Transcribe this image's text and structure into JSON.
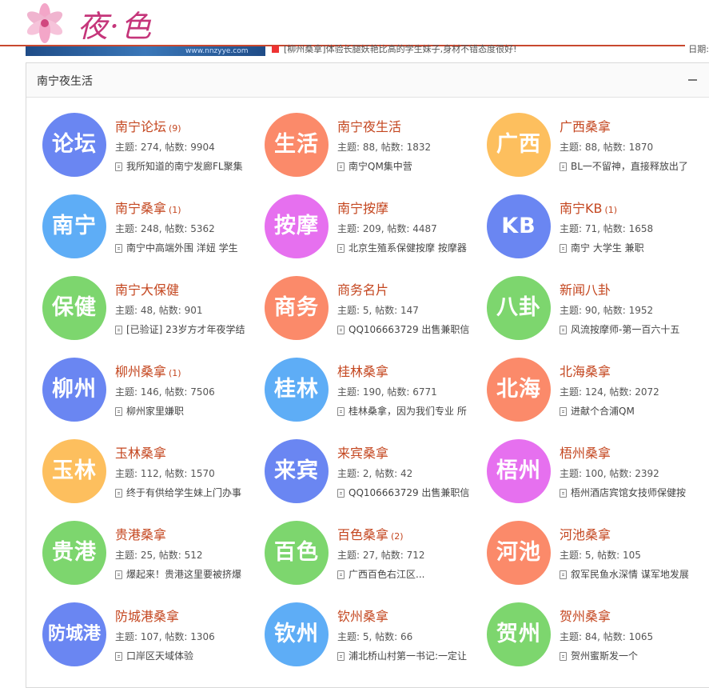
{
  "header": {
    "logo_text": "夜·色",
    "banner_url": "www.nnzyye.com",
    "ticker_text": "[柳州桑拿]体验长腿妖艳比高的学生妹子,身材不错态度很好!",
    "ticker_right": "日期:"
  },
  "panel": {
    "title": "南宁夜生活"
  },
  "labels": {
    "stats_prefix_topics": "主题: ",
    "stats_prefix_posts": "帖数: "
  },
  "forums": [
    {
      "badge": "论坛",
      "color": "#6a86f2",
      "name": "南宁论坛",
      "count": "(9)",
      "topics": "274",
      "posts": "9904",
      "last": "我所知道的南宁发廊FL聚集"
    },
    {
      "badge": "生活",
      "color": "#fb8a6a",
      "name": "南宁夜生活",
      "count": "",
      "topics": "88",
      "posts": "1832",
      "last": "南宁QM集中营"
    },
    {
      "badge": "广西",
      "color": "#fdbf5e",
      "name": "广西桑拿",
      "count": "",
      "topics": "88",
      "posts": "1870",
      "last": "BL一不留神，直接释放出了"
    },
    {
      "badge": "南宁",
      "color": "#5eadf6",
      "name": "南宁桑拿",
      "count": "(1)",
      "topics": "248",
      "posts": "5362",
      "last": "南宁中高端外围 洋妞 学生"
    },
    {
      "badge": "按摩",
      "color": "#e670ef",
      "name": "南宁按摩",
      "count": "",
      "topics": "209",
      "posts": "4487",
      "last": "北京生殖系保健按摩 按摩器"
    },
    {
      "badge": "KB",
      "color": "#6a86f2",
      "name": "南宁KB",
      "count": "(1)",
      "topics": "71",
      "posts": "1658",
      "last": "南宁 大学生 兼职"
    },
    {
      "badge": "保健",
      "color": "#7dd66e",
      "name": "南宁大保健",
      "count": "",
      "topics": "48",
      "posts": "901",
      "last": "[已验证] 23岁方才年夜学结"
    },
    {
      "badge": "商务",
      "color": "#fb8a6a",
      "name": "商务名片",
      "count": "",
      "topics": "5",
      "posts": "147",
      "last": "QQ106663729 出售兼职信"
    },
    {
      "badge": "八卦",
      "color": "#7dd66e",
      "name": "新闻八卦",
      "count": "",
      "topics": "90",
      "posts": "1952",
      "last": "风流按摩师-第一百六十五"
    },
    {
      "badge": "柳州",
      "color": "#6a86f2",
      "name": "柳州桑拿",
      "count": "(1)",
      "topics": "146",
      "posts": "7506",
      "last": "柳州家里嫌职"
    },
    {
      "badge": "桂林",
      "color": "#5eadf6",
      "name": "桂林桑拿",
      "count": "",
      "topics": "190",
      "posts": "6771",
      "last": "桂林桑拿，因为我们专业 所"
    },
    {
      "badge": "北海",
      "color": "#fb8a6a",
      "name": "北海桑拿",
      "count": "",
      "topics": "124",
      "posts": "2072",
      "last": "进献个合浦QM"
    },
    {
      "badge": "玉林",
      "color": "#fdbf5e",
      "name": "玉林桑拿",
      "count": "",
      "topics": "112",
      "posts": "1570",
      "last": "终于有供给学生妹上门办事"
    },
    {
      "badge": "来宾",
      "color": "#6a86f2",
      "name": "来宾桑拿",
      "count": "",
      "topics": "2",
      "posts": "42",
      "last": "QQ106663729 出售兼职信"
    },
    {
      "badge": "梧州",
      "color": "#e670ef",
      "name": "梧州桑拿",
      "count": "",
      "topics": "100",
      "posts": "2392",
      "last": "梧州酒店宾馆女技师保健按"
    },
    {
      "badge": "贵港",
      "color": "#7dd66e",
      "name": "贵港桑拿",
      "count": "",
      "topics": "25",
      "posts": "512",
      "last": "爆起来！贵港这里要被挤爆"
    },
    {
      "badge": "百色",
      "color": "#7dd66e",
      "name": "百色桑拿",
      "count": "(2)",
      "topics": "27",
      "posts": "712",
      "last": "广西百色右江区..."
    },
    {
      "badge": "河池",
      "color": "#fb8a6a",
      "name": "河池桑拿",
      "count": "",
      "topics": "5",
      "posts": "105",
      "last": "叙军民鱼水深情 谋军地发展"
    },
    {
      "badge": "防城港",
      "color": "#6a86f2",
      "name": "防城港桑拿",
      "count": "",
      "topics": "107",
      "posts": "1306",
      "last": "口岸区天域体验"
    },
    {
      "badge": "钦州",
      "color": "#5eadf6",
      "name": "钦州桑拿",
      "count": "",
      "topics": "5",
      "posts": "66",
      "last": "浦北桥山村第一书记:一定让"
    },
    {
      "badge": "贺州",
      "color": "#7dd66e",
      "name": "贺州桑拿",
      "count": "",
      "topics": "84",
      "posts": "1065",
      "last": "贺州蜜斯发一个"
    }
  ]
}
